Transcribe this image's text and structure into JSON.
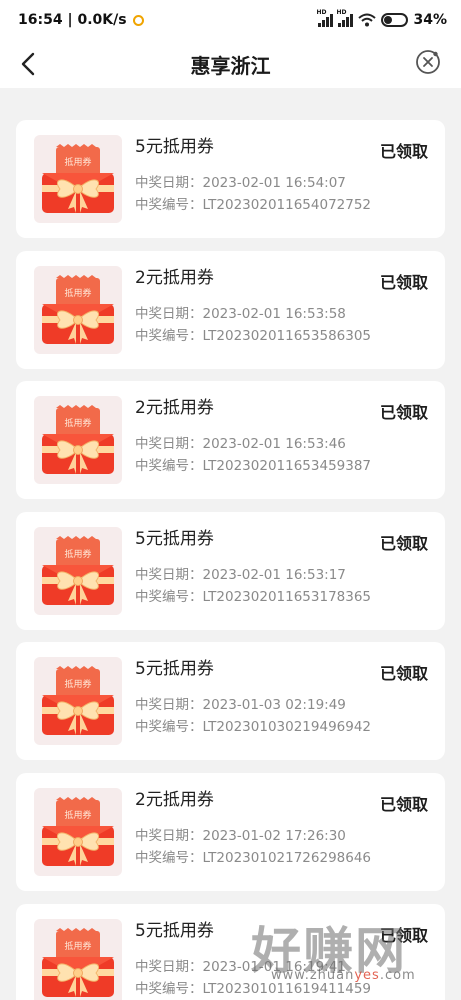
{
  "status_bar": {
    "time": "16:54",
    "speed": "0.0K/s",
    "network_label_1": "HD",
    "network_label_2": "HD",
    "battery": "34%"
  },
  "header": {
    "title": "惠享浙江"
  },
  "thumb_text": "抵用券",
  "records": [
    {
      "title": "5元抵用券",
      "status": "已领取",
      "date_label": "中奖日期：",
      "date": "2023-02-01 16:54:07",
      "no_label": "中奖编号：",
      "no": "LT202302011654072752"
    },
    {
      "title": "2元抵用券",
      "status": "已领取",
      "date_label": "中奖日期：",
      "date": "2023-02-01 16:53:58",
      "no_label": "中奖编号：",
      "no": "LT202302011653586305"
    },
    {
      "title": "2元抵用券",
      "status": "已领取",
      "date_label": "中奖日期：",
      "date": "2023-02-01 16:53:46",
      "no_label": "中奖编号：",
      "no": "LT202302011653459387"
    },
    {
      "title": "5元抵用券",
      "status": "已领取",
      "date_label": "中奖日期：",
      "date": "2023-02-01 16:53:17",
      "no_label": "中奖编号：",
      "no": "LT202302011653178365"
    },
    {
      "title": "5元抵用券",
      "status": "已领取",
      "date_label": "中奖日期：",
      "date": "2023-01-03 02:19:49",
      "no_label": "中奖编号：",
      "no": "LT202301030219496942"
    },
    {
      "title": "2元抵用券",
      "status": "已领取",
      "date_label": "中奖日期：",
      "date": "2023-01-02 17:26:30",
      "no_label": "中奖编号：",
      "no": "LT202301021726298646"
    },
    {
      "title": "5元抵用券",
      "status": "已领取",
      "date_label": "中奖日期：",
      "date": "2023-01-01 16:19:41",
      "no_label": "中奖编号：",
      "no": "LT202301011619411459"
    }
  ],
  "watermark": {
    "main": "好赚网",
    "site_pre": "www.zhuan",
    "site_hl": "yes",
    "site_post": ".com"
  },
  "colors": {
    "accent_red": "#f04a2e",
    "ribbon_gold": "#ffd9a0"
  }
}
